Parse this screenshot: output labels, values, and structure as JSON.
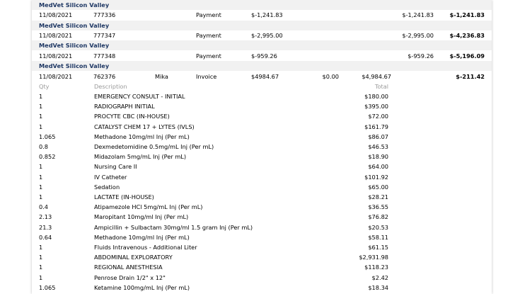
{
  "payments": [
    {
      "vendor": "MedVet Silicon Valley",
      "date": "11/08/2021",
      "number": "777336",
      "type": "Payment",
      "amount": "$-1,241.83",
      "applied": "$-1,241.83",
      "balance": "$-1,241.83"
    },
    {
      "vendor": "MedVet Silicon Valley",
      "date": "11/08/2021",
      "number": "777347",
      "type": "Payment",
      "amount": "$-2,995.00",
      "applied": "$-2,995.00",
      "balance": "$-4,236.83"
    },
    {
      "vendor": "MedVet Silicon Valley",
      "date": "11/08/2021",
      "number": "777348",
      "type": "Payment",
      "amount": "$-959.26",
      "applied": "$-959.26",
      "balance": "$-5,196.09"
    }
  ],
  "invoice": {
    "vendor": "MedVet Silicon Valley",
    "date": "11/08/2021",
    "number": "762376",
    "name": "Mika",
    "type": "Invoice",
    "amount": "$4984.67",
    "paid": "$0.00",
    "total": "$4,984.67",
    "balance": "$-211.42"
  },
  "line_items_header": {
    "qty": "Qty",
    "description": "Description",
    "total": "Total"
  },
  "line_items": [
    {
      "qty": "1",
      "description": "EMERGENCY CONSULT - INITIAL",
      "total": "$180.00"
    },
    {
      "qty": "1",
      "description": "RADIOGRAPH INITIAL",
      "total": "$395.00"
    },
    {
      "qty": "1",
      "description": "PROCYTE CBC (IN-HOUSE)",
      "total": "$72.00"
    },
    {
      "qty": "1",
      "description": "CATALYST CHEM 17 + LYTES (IVLS)",
      "total": "$161.79"
    },
    {
      "qty": "1.065",
      "description": "Methadone 10mg/ml Inj (Per mL)",
      "total": "$86.07"
    },
    {
      "qty": "0.8",
      "description": "Dexmedetomidine 0.5mg/mL Inj (Per mL)",
      "total": "$46.53"
    },
    {
      "qty": "0.852",
      "description": "Midazolam 5mg/mL Inj (Per mL)",
      "total": "$18.90"
    },
    {
      "qty": "1",
      "description": "Nursing Care II",
      "total": "$64.00"
    },
    {
      "qty": "1",
      "description": "IV Catheter",
      "total": "$101.92"
    },
    {
      "qty": "1",
      "description": "Sedation",
      "total": "$65.00"
    },
    {
      "qty": "1",
      "description": "LACTATE (IN-HOUSE)",
      "total": "$28.21"
    },
    {
      "qty": "0.4",
      "description": "Atipamezole HCl 5mg/mL Inj (Per mL)",
      "total": "$36.55"
    },
    {
      "qty": "2.13",
      "description": "Maropitant 10mg/ml Inj (Per mL)",
      "total": "$76.82"
    },
    {
      "qty": "21.3",
      "description": "Ampicillin + Sulbactam 30mg/ml 1.5 gram Inj (Per mL)",
      "total": "$20.53"
    },
    {
      "qty": "0.64",
      "description": "Methadone 10mg/ml Inj (Per mL)",
      "total": "$58.11"
    },
    {
      "qty": "1",
      "description": "Fluids Intravenous - Additional Liter",
      "total": "$61.15"
    },
    {
      "qty": "1",
      "description": "ABDOMINAL EXPLORATORY",
      "total": "$2,931.98"
    },
    {
      "qty": "1",
      "description": "REGIONAL ANESTHESIA",
      "total": "$118.23"
    },
    {
      "qty": "1",
      "description": "Penrose Drain 1/2\" x 12\"",
      "total": "$2.42"
    },
    {
      "qty": "1.065",
      "description": "Ketamine 100mg/mL Inj (Per mL)",
      "total": "$18.34"
    }
  ]
}
